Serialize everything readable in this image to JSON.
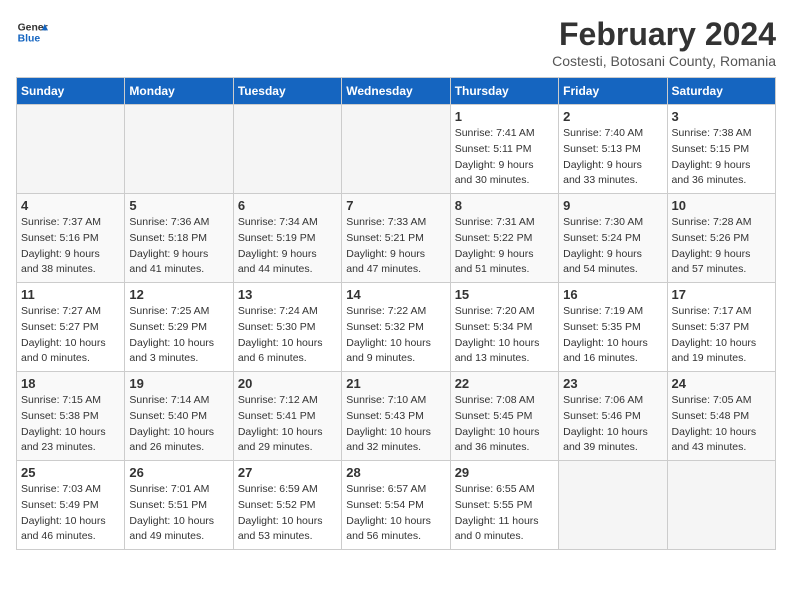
{
  "header": {
    "logo_line1": "General",
    "logo_line2": "Blue",
    "month_title": "February 2024",
    "subtitle": "Costesti, Botosani County, Romania"
  },
  "days_of_week": [
    "Sunday",
    "Monday",
    "Tuesday",
    "Wednesday",
    "Thursday",
    "Friday",
    "Saturday"
  ],
  "weeks": [
    [
      {
        "day": "",
        "info": ""
      },
      {
        "day": "",
        "info": ""
      },
      {
        "day": "",
        "info": ""
      },
      {
        "day": "",
        "info": ""
      },
      {
        "day": "1",
        "info": "Sunrise: 7:41 AM\nSunset: 5:11 PM\nDaylight: 9 hours\nand 30 minutes."
      },
      {
        "day": "2",
        "info": "Sunrise: 7:40 AM\nSunset: 5:13 PM\nDaylight: 9 hours\nand 33 minutes."
      },
      {
        "day": "3",
        "info": "Sunrise: 7:38 AM\nSunset: 5:15 PM\nDaylight: 9 hours\nand 36 minutes."
      }
    ],
    [
      {
        "day": "4",
        "info": "Sunrise: 7:37 AM\nSunset: 5:16 PM\nDaylight: 9 hours\nand 38 minutes."
      },
      {
        "day": "5",
        "info": "Sunrise: 7:36 AM\nSunset: 5:18 PM\nDaylight: 9 hours\nand 41 minutes."
      },
      {
        "day": "6",
        "info": "Sunrise: 7:34 AM\nSunset: 5:19 PM\nDaylight: 9 hours\nand 44 minutes."
      },
      {
        "day": "7",
        "info": "Sunrise: 7:33 AM\nSunset: 5:21 PM\nDaylight: 9 hours\nand 47 minutes."
      },
      {
        "day": "8",
        "info": "Sunrise: 7:31 AM\nSunset: 5:22 PM\nDaylight: 9 hours\nand 51 minutes."
      },
      {
        "day": "9",
        "info": "Sunrise: 7:30 AM\nSunset: 5:24 PM\nDaylight: 9 hours\nand 54 minutes."
      },
      {
        "day": "10",
        "info": "Sunrise: 7:28 AM\nSunset: 5:26 PM\nDaylight: 9 hours\nand 57 minutes."
      }
    ],
    [
      {
        "day": "11",
        "info": "Sunrise: 7:27 AM\nSunset: 5:27 PM\nDaylight: 10 hours\nand 0 minutes."
      },
      {
        "day": "12",
        "info": "Sunrise: 7:25 AM\nSunset: 5:29 PM\nDaylight: 10 hours\nand 3 minutes."
      },
      {
        "day": "13",
        "info": "Sunrise: 7:24 AM\nSunset: 5:30 PM\nDaylight: 10 hours\nand 6 minutes."
      },
      {
        "day": "14",
        "info": "Sunrise: 7:22 AM\nSunset: 5:32 PM\nDaylight: 10 hours\nand 9 minutes."
      },
      {
        "day": "15",
        "info": "Sunrise: 7:20 AM\nSunset: 5:34 PM\nDaylight: 10 hours\nand 13 minutes."
      },
      {
        "day": "16",
        "info": "Sunrise: 7:19 AM\nSunset: 5:35 PM\nDaylight: 10 hours\nand 16 minutes."
      },
      {
        "day": "17",
        "info": "Sunrise: 7:17 AM\nSunset: 5:37 PM\nDaylight: 10 hours\nand 19 minutes."
      }
    ],
    [
      {
        "day": "18",
        "info": "Sunrise: 7:15 AM\nSunset: 5:38 PM\nDaylight: 10 hours\nand 23 minutes."
      },
      {
        "day": "19",
        "info": "Sunrise: 7:14 AM\nSunset: 5:40 PM\nDaylight: 10 hours\nand 26 minutes."
      },
      {
        "day": "20",
        "info": "Sunrise: 7:12 AM\nSunset: 5:41 PM\nDaylight: 10 hours\nand 29 minutes."
      },
      {
        "day": "21",
        "info": "Sunrise: 7:10 AM\nSunset: 5:43 PM\nDaylight: 10 hours\nand 32 minutes."
      },
      {
        "day": "22",
        "info": "Sunrise: 7:08 AM\nSunset: 5:45 PM\nDaylight: 10 hours\nand 36 minutes."
      },
      {
        "day": "23",
        "info": "Sunrise: 7:06 AM\nSunset: 5:46 PM\nDaylight: 10 hours\nand 39 minutes."
      },
      {
        "day": "24",
        "info": "Sunrise: 7:05 AM\nSunset: 5:48 PM\nDaylight: 10 hours\nand 43 minutes."
      }
    ],
    [
      {
        "day": "25",
        "info": "Sunrise: 7:03 AM\nSunset: 5:49 PM\nDaylight: 10 hours\nand 46 minutes."
      },
      {
        "day": "26",
        "info": "Sunrise: 7:01 AM\nSunset: 5:51 PM\nDaylight: 10 hours\nand 49 minutes."
      },
      {
        "day": "27",
        "info": "Sunrise: 6:59 AM\nSunset: 5:52 PM\nDaylight: 10 hours\nand 53 minutes."
      },
      {
        "day": "28",
        "info": "Sunrise: 6:57 AM\nSunset: 5:54 PM\nDaylight: 10 hours\nand 56 minutes."
      },
      {
        "day": "29",
        "info": "Sunrise: 6:55 AM\nSunset: 5:55 PM\nDaylight: 11 hours\nand 0 minutes."
      },
      {
        "day": "",
        "info": ""
      },
      {
        "day": "",
        "info": ""
      }
    ]
  ]
}
